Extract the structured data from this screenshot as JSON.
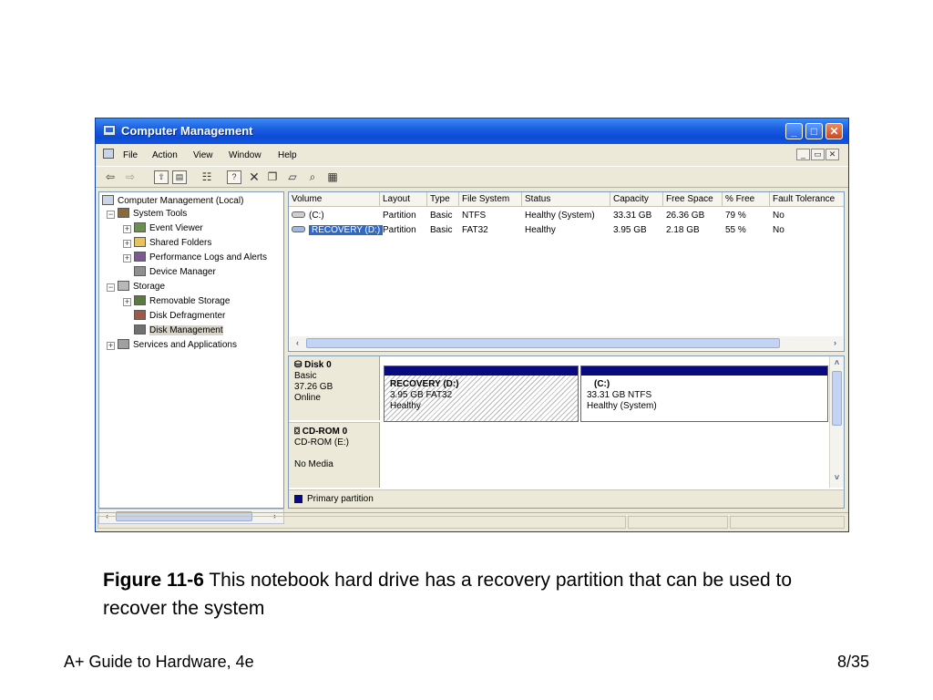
{
  "window": {
    "title": "Computer Management",
    "controls": {
      "minimize": "_",
      "maximize": "□",
      "close": "✕"
    },
    "mdi_controls": [
      "_",
      "▭",
      "✕"
    ]
  },
  "menu": [
    "File",
    "Action",
    "View",
    "Window",
    "Help"
  ],
  "toolbar_icons": [
    "back-arrow-icon",
    "forward-arrow-icon",
    "up-folder-icon",
    "show-hide-tree-icon",
    "properties-icon",
    "help-icon",
    "delete-icon",
    "new-window-icon",
    "open-icon",
    "refresh-icon",
    "export-icon"
  ],
  "tree": [
    {
      "label": "Computer Management (Local)",
      "icon": "computer-icon"
    },
    {
      "label": "System Tools",
      "icon": "tools-icon"
    },
    {
      "label": "Event Viewer",
      "icon": "event-viewer-icon"
    },
    {
      "label": "Shared Folders",
      "icon": "shared-folder-icon"
    },
    {
      "label": "Performance Logs and Alerts",
      "icon": "performance-icon"
    },
    {
      "label": "Device Manager",
      "icon": "device-manager-icon"
    },
    {
      "label": "Storage",
      "icon": "storage-icon"
    },
    {
      "label": "Removable Storage",
      "icon": "removable-storage-icon"
    },
    {
      "label": "Disk Defragmenter",
      "icon": "defrag-icon"
    },
    {
      "label": "Disk Management",
      "icon": "disk-management-icon"
    },
    {
      "label": "Services and Applications",
      "icon": "services-icon"
    }
  ],
  "volumes": {
    "columns": [
      "Volume",
      "Layout",
      "Type",
      "File System",
      "Status",
      "Capacity",
      "Free Space",
      "% Free",
      "Fault Tolerance"
    ],
    "rows": [
      [
        "(C:)",
        "Partition",
        "Basic",
        "NTFS",
        "Healthy (System)",
        "33.31 GB",
        "26.36 GB",
        "79 %",
        "No"
      ],
      [
        "RECOVERY (D:)",
        "Partition",
        "Basic",
        "FAT32",
        "Healthy",
        "3.95 GB",
        "2.18 GB",
        "55 %",
        "No"
      ]
    ]
  },
  "disks": [
    {
      "name": "Disk 0",
      "kind": "Basic",
      "size": "37.26 GB",
      "state": "Online",
      "partitions": [
        {
          "name": "RECOVERY  (D:)",
          "detail": "3.95 GB FAT32",
          "status": "Healthy"
        },
        {
          "name": "(C:)",
          "detail": "33.31 GB NTFS",
          "status": "Healthy (System)"
        }
      ]
    },
    {
      "name": "CD-ROM 0",
      "kind": "CD-ROM (E:)",
      "media": "No Media"
    }
  ],
  "legend": "Primary partition",
  "slide": {
    "caption_label": "Figure 11-6",
    "caption_text": " This notebook hard drive has a recovery partition that can be used to recover the system",
    "footer_left": "A+ Guide to Hardware, 4e",
    "footer_right": "8/35"
  },
  "colors": {
    "titlebar": "#0b4bd6",
    "selection": "#316ac5",
    "partition_bar": "#0a0a80",
    "chrome": "#ece9d8"
  }
}
